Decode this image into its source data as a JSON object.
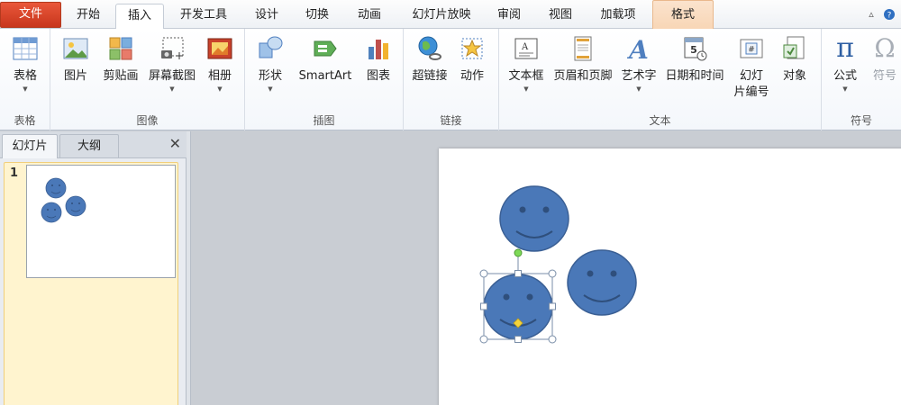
{
  "tabs": {
    "file": "文件",
    "home": "开始",
    "insert": "插入",
    "developer": "开发工具",
    "design": "设计",
    "transitions": "切换",
    "animations": "动画",
    "slideshow": "幻灯片放映",
    "review": "审阅",
    "view": "视图",
    "addins": "加载项",
    "format": "格式"
  },
  "ribbon": {
    "groups": {
      "table": "表格",
      "images": "图像",
      "illustrations": "插图",
      "links": "链接",
      "text": "文本",
      "symbols": "符号"
    },
    "buttons": {
      "table": "表格",
      "picture": "图片",
      "clipart": "剪贴画",
      "screenshot": "屏幕截图",
      "album": "相册",
      "shapes": "形状",
      "smartart": "SmartArt",
      "chart": "图表",
      "hyperlink": "超链接",
      "action": "动作",
      "textbox": "文本框",
      "headerfooter": "页眉和页脚",
      "wordart": "艺术字",
      "datetime": "日期和时间",
      "slidenum_1": "幻灯",
      "slidenum_2": "片编号",
      "object": "对象",
      "equation": "公式",
      "symbol": "符号"
    },
    "glyphs": {
      "pi": "π",
      "omega": "Ω",
      "wordart_a": "A",
      "date_5": "5",
      "hash": "#"
    }
  },
  "panel": {
    "tab_slides": "幻灯片",
    "tab_outline": "大纲",
    "close": "✕",
    "slide_number": "1"
  },
  "colors": {
    "shape_fill": "#4a78b8",
    "shape_stroke": "#3a5f94",
    "file_tab": "#d24726",
    "format_tab": "#f8d8b8"
  }
}
